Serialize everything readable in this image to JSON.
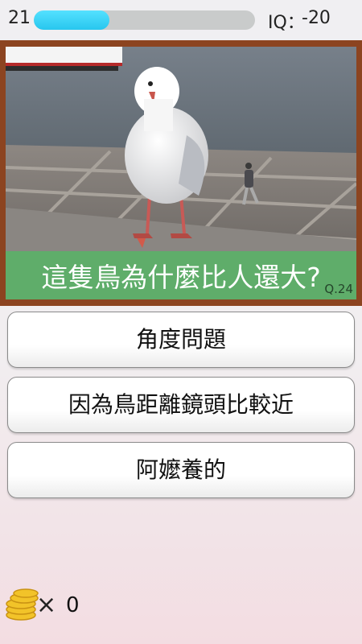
{
  "header": {
    "timer": "21",
    "progress_fraction": 0.34,
    "iq_label": "IQ：",
    "iq_value": "-20"
  },
  "question": {
    "text": "這隻鳥為什麼比人還大?",
    "number": "Q.24"
  },
  "answers": [
    {
      "label": "角度問題"
    },
    {
      "label": "因為鳥距離鏡頭比較近"
    },
    {
      "label": "阿嬤養的"
    }
  ],
  "coins": {
    "times_symbol": "×",
    "count": "0",
    "icon": "coin-stack-icon"
  },
  "colors": {
    "frame": "#8c4420",
    "question_bar": "#5fad6a",
    "progress_fill": "#27c6ee"
  }
}
